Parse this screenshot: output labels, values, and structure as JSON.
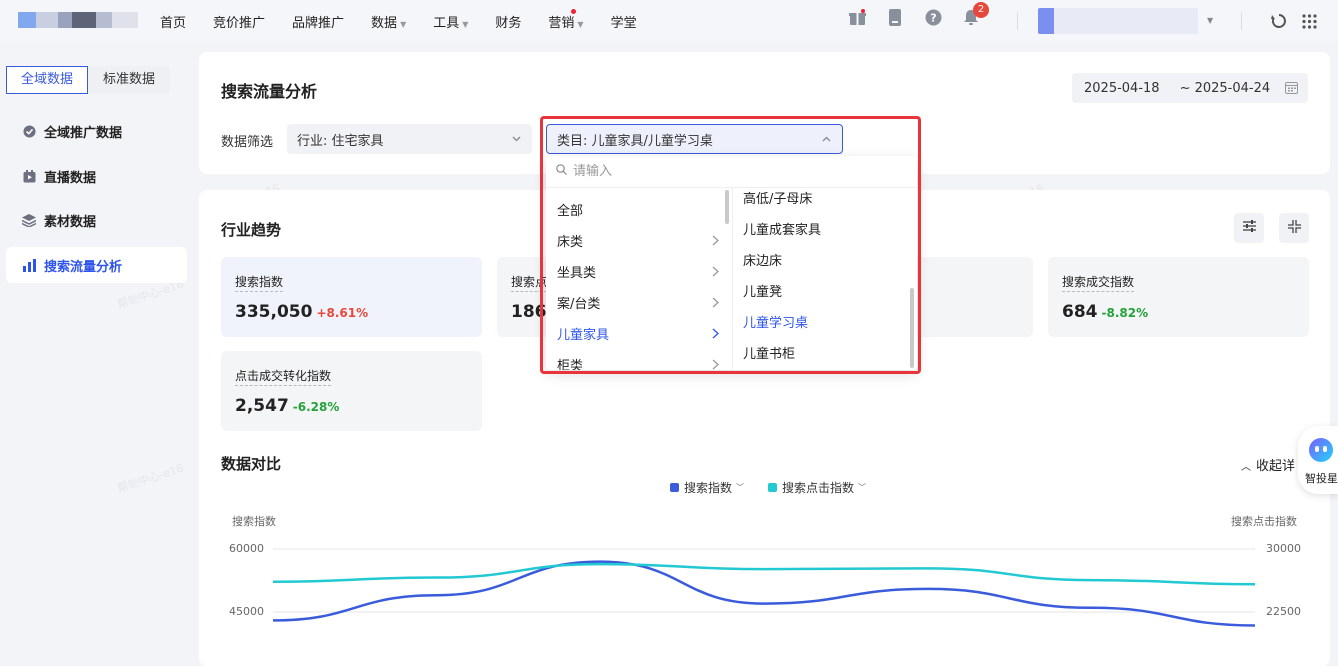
{
  "nav": {
    "items": [
      {
        "label": "首页",
        "caret": false,
        "dot": false
      },
      {
        "label": "竞价推广",
        "caret": false,
        "dot": false
      },
      {
        "label": "品牌推广",
        "caret": false,
        "dot": false
      },
      {
        "label": "数据",
        "caret": true,
        "dot": false
      },
      {
        "label": "工具",
        "caret": true,
        "dot": false
      },
      {
        "label": "财务",
        "caret": false,
        "dot": false
      },
      {
        "label": "营销",
        "caret": true,
        "dot": true
      },
      {
        "label": "学堂",
        "caret": false,
        "dot": false
      }
    ],
    "notification_count": "2",
    "icons": [
      "gift-icon",
      "document-icon",
      "help-icon",
      "bell-icon",
      "refresh-icon",
      "grid-icon"
    ]
  },
  "sidebar": {
    "tabs": [
      "全域数据",
      "标准数据"
    ],
    "active_tab": 0,
    "items": [
      {
        "label": "全域推广数据",
        "icon": "check-circle-icon",
        "active": false
      },
      {
        "label": "直播数据",
        "icon": "live-icon",
        "active": false
      },
      {
        "label": "素材数据",
        "icon": "layers-icon",
        "active": false
      },
      {
        "label": "搜索流量分析",
        "icon": "bar-chart-icon",
        "active": true
      }
    ]
  },
  "header": {
    "title": "搜索流量分析",
    "date_start": "2025-04-18",
    "date_end": "~ 2025-04-24"
  },
  "filters": {
    "label": "数据筛选",
    "industry": "行业:  住宅家具",
    "category": "类目:  儿童家具/儿童学习桌"
  },
  "dropdown": {
    "search_placeholder": "请输入",
    "left": [
      {
        "label": "全部",
        "arrow": false,
        "active": false
      },
      {
        "label": "床类",
        "arrow": true,
        "active": false
      },
      {
        "label": "坐具类",
        "arrow": true,
        "active": false
      },
      {
        "label": "案/台类",
        "arrow": true,
        "active": false
      },
      {
        "label": "儿童家具",
        "arrow": true,
        "active": true
      },
      {
        "label": "柜类",
        "arrow": true,
        "active": false
      }
    ],
    "right": [
      {
        "label": "高低/子母床",
        "active": false
      },
      {
        "label": "儿童成套家具",
        "active": false
      },
      {
        "label": "床边床",
        "active": false
      },
      {
        "label": "儿童凳",
        "active": false
      },
      {
        "label": "儿童学习桌",
        "active": true
      },
      {
        "label": "儿童书柜",
        "active": false
      }
    ]
  },
  "trend": {
    "title": "行业趋势",
    "metrics": [
      {
        "label": "搜索指数",
        "value": "335,050",
        "change": "+8.61%",
        "dir": "up",
        "selected": true
      },
      {
        "label": "搜索点",
        "value": "186,",
        "change": "",
        "dir": "up",
        "selected": false
      },
      {
        "label": "搜索成交指数",
        "value": "684",
        "change": "-8.82%",
        "dir": "down",
        "selected": false
      },
      {
        "label": "点击成交转化指数",
        "value": "2,547",
        "change": "-6.28%",
        "dir": "down",
        "selected": false
      }
    ]
  },
  "compare": {
    "title": "数据对比",
    "collapse_label": "收起详"
  },
  "assistant": {
    "label": "智投星"
  },
  "watermark": "帮助中心-e16",
  "chart_data": {
    "type": "line",
    "ylabel": "搜索指数",
    "y2label": "搜索点击指数",
    "yticks": [
      "60000",
      "45000"
    ],
    "y2ticks": [
      "30000",
      "22500"
    ],
    "ylim": [
      45000,
      60000
    ],
    "y2lim": [
      22500,
      30000
    ],
    "series": [
      {
        "name": "搜索指数",
        "color": "#3a5bdc",
        "axis": "left",
        "values": [
          43000,
          49000,
          57000,
          47000,
          50500,
          46000,
          41800
        ]
      },
      {
        "name": "搜索点击指数",
        "color": "#22c8d2",
        "axis": "right",
        "values": [
          26100,
          26600,
          28200,
          27600,
          27700,
          26300,
          25800
        ]
      }
    ]
  }
}
